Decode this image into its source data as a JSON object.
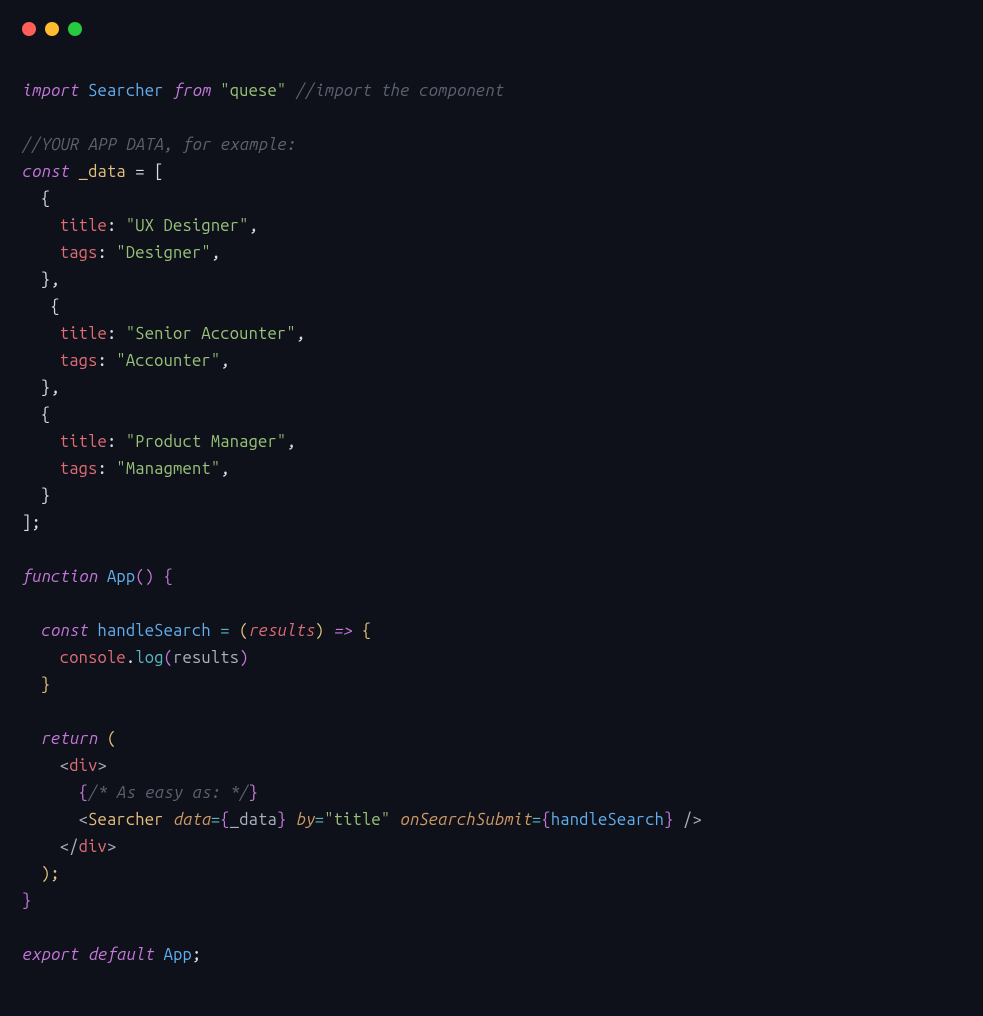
{
  "code_tokens": {
    "line1": {
      "import": "import",
      "searcher": "Searcher",
      "from": "from",
      "quese": "\"quese\"",
      "comment": "//import the component"
    },
    "line3_comment": "//YOUR APP DATA, for example:",
    "line4": {
      "const": "const",
      "data_var": "_data",
      "eq_open": " = ["
    },
    "line5": "  {",
    "line6": {
      "indent": "    ",
      "key": "title",
      "colon": ": ",
      "val": "\"UX Designer\"",
      "comma": ","
    },
    "line7": {
      "indent": "    ",
      "key": "tags",
      "colon": ": ",
      "val": "\"Designer\"",
      "comma": ","
    },
    "line8": "  },",
    "line9": "   {",
    "line10": {
      "indent": "    ",
      "key": "title",
      "colon": ": ",
      "val": "\"Senior Accounter\"",
      "comma": ","
    },
    "line11": {
      "indent": "    ",
      "key": "tags",
      "colon": ": ",
      "val": "\"Accounter\"",
      "comma": ","
    },
    "line12": "  },",
    "line13": "  {",
    "line14": {
      "indent": "    ",
      "key": "title",
      "colon": ": ",
      "val": "\"Product Manager\"",
      "comma": ","
    },
    "line15": {
      "indent": "    ",
      "key": "tags",
      "colon": ": ",
      "val": "\"Managment\"",
      "comma": ","
    },
    "line16": "  }",
    "line17": "];",
    "line19": {
      "function": "function",
      "name": "App",
      "parens": "() ",
      "brace": "{"
    },
    "line21": {
      "indent": "  ",
      "const": "const",
      "hname": " handleSearch ",
      "eq": "= ",
      "open": "(",
      "param": "results",
      "close": ") ",
      "arrow": "=>",
      "brace": " {"
    },
    "line22": {
      "indent": "    ",
      "console": "console",
      "dot": ".",
      "log": "log",
      "open": "(",
      "arg": "results",
      "close": ")"
    },
    "line23": "  }",
    "line25": {
      "indent": "  ",
      "return": "return",
      "paren": " ("
    },
    "line26": {
      "indent": "    <",
      "tag": "div",
      "close": ">"
    },
    "line27": {
      "indent": "      ",
      "open": "{",
      "comment": "/* As easy as: */",
      "close": "}"
    },
    "line28": {
      "indent": "      <",
      "tag": "Searcher",
      "sp1": " ",
      "a1": "data",
      "eq1": "=",
      "bo1": "{",
      "v1": "_data",
      "bc1": "}",
      "sp2": " ",
      "a2": "by",
      "eq2": "=",
      "v2": "\"title\"",
      "sp3": " ",
      "a3": "onSearchSubmit",
      "eq3": "=",
      "bo3": "{",
      "v3": "handleSearch",
      "bc3": "}",
      "end": " />"
    },
    "line29": {
      "indent": "    </",
      "tag": "div",
      "close": ">"
    },
    "line30": "  );",
    "line31": "}",
    "line33": {
      "export": "export",
      "default": "default",
      "app": "App",
      "semi": ";"
    }
  }
}
